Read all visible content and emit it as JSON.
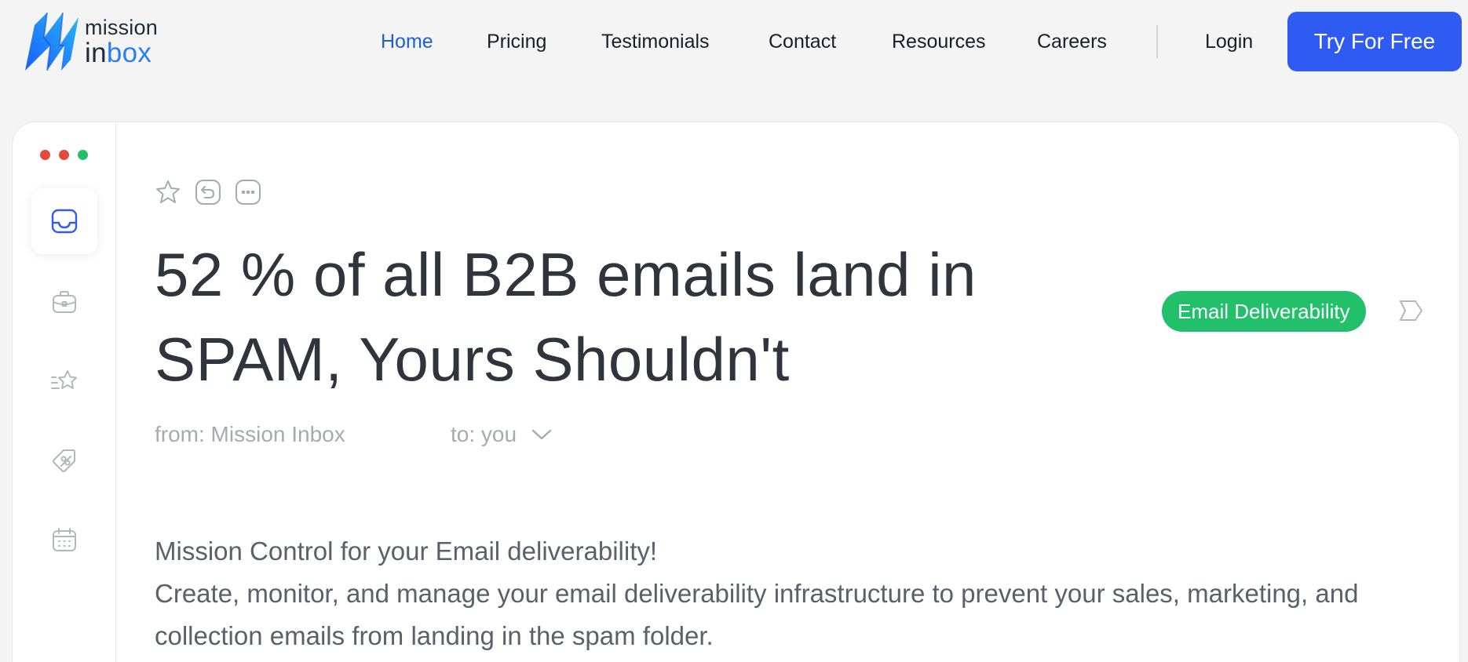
{
  "brand": {
    "line1": "mission",
    "line2_a": "in",
    "line2_b": "box",
    "accent": "#2f5bf2",
    "logo_gradient": [
      "#1a5cff",
      "#29b8f3"
    ]
  },
  "nav": {
    "items": [
      "Home",
      "Pricing",
      "Testimonials",
      "Contact",
      "Resources",
      "Careers"
    ],
    "active": "Home",
    "login": "Login",
    "cta": "Try For Free"
  },
  "window_dots": [
    "#e5493a",
    "#e5493a",
    "#22c06b"
  ],
  "sidebar": {
    "icons": [
      "inbox-icon",
      "briefcase-icon",
      "starred-list-icon",
      "tag-icon",
      "calendar-icon"
    ],
    "active": "inbox-icon"
  },
  "toolbar": {
    "icons": [
      "star-icon",
      "reply-icon",
      "more-icon"
    ]
  },
  "email": {
    "subject": "52 % of all B2B emails land in SPAM, Yours Shouldn't",
    "tag": "Email Deliverability",
    "tag_color": "#22c06b",
    "from": "from: Mission Inbox",
    "to": "to: you",
    "body_line1": "Mission Control for your Email deliverability!",
    "body_line2": "Create, monitor, and manage your email deliverability infrastructure to prevent your sales, marketing, and collection emails from landing in the spam folder."
  }
}
